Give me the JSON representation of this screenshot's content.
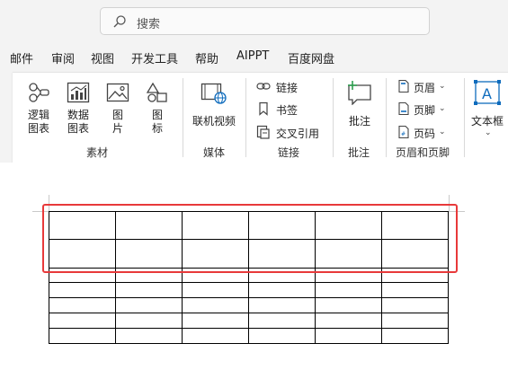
{
  "search": {
    "placeholder": "搜索"
  },
  "menu": {
    "items": [
      "邮件",
      "审阅",
      "视图",
      "开发工具",
      "帮助",
      "AIPPT",
      "百度网盘"
    ]
  },
  "ribbon": {
    "groups": {
      "sucai": {
        "label": "素材",
        "buttons": [
          {
            "l1": "逻辑",
            "l2": "图表"
          },
          {
            "l1": "数据",
            "l2": "图表"
          },
          {
            "l1": "图",
            "l2": "片"
          },
          {
            "l1": "图",
            "l2": "标"
          }
        ]
      },
      "meiti": {
        "label": "媒体",
        "button": "联机视频"
      },
      "lianjie": {
        "label": "链接",
        "items": [
          "链接",
          "书签",
          "交叉引用"
        ]
      },
      "pizhu": {
        "label": "批注",
        "button": "批注"
      },
      "yemei": {
        "label": "页眉和页脚",
        "items": [
          "页眉",
          "页脚",
          "页码"
        ]
      },
      "wenben": {
        "button": "文本框"
      }
    }
  },
  "colors": {
    "accent": "#0f6cbd",
    "selection": "#e8393a",
    "comment": "#2e9e4f"
  },
  "table": {
    "rows": 7,
    "cols": 6,
    "selected_rows": 2
  }
}
